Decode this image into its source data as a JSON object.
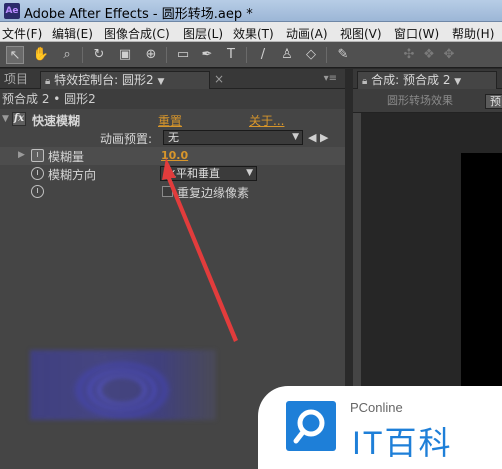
{
  "window": {
    "title": "Adobe After Effects - 圆形转场.aep *",
    "app_icon_text": "Ae"
  },
  "menu": [
    "文件(F)",
    "编辑(E)",
    "图像合成(C)",
    "图层(L)",
    "效果(T)",
    "动画(A)",
    "视图(V)",
    "窗口(W)",
    "帮助(H)"
  ],
  "toolbar": {
    "icons": [
      "selection-tool-icon",
      "hand-tool-icon",
      "zoom-tool-icon",
      "rotate-tool-icon",
      "camera-tool-icon",
      "pan-behind-icon",
      "rectangle-tool-icon",
      "pen-tool-icon",
      "type-tool-icon",
      "brush-tool-icon",
      "clone-stamp-icon",
      "eraser-tool-icon",
      "puppet-pin-icon"
    ],
    "right_icons": [
      "axis-icon",
      "axis-icon-2",
      "axis-icon-3"
    ]
  },
  "effects_panel": {
    "project_tab": "项目",
    "tab_label": "特效控制台: 圆形2",
    "breadcrumb": "预合成 2 • 圆形2",
    "effect": {
      "name": "快速模糊",
      "reset": "重置",
      "about": "关于...",
      "preset_label": "动画预置:",
      "preset_value": "无",
      "blurriness_label": "模糊量",
      "blurriness_value": "10.0",
      "direction_label": "模糊方向",
      "direction_value": "水平和垂直",
      "repeat_edge_label": "重复边缘像素",
      "repeat_edge_checked": false
    }
  },
  "comp_panel": {
    "tab_label": "合成: 预合成 2",
    "crumb_1": "圆形转场效果",
    "crumb_2": "预"
  },
  "watermark": {
    "brand_small": "PConline",
    "brand_big": "IT百科"
  },
  "colors": {
    "accent_link": "#d8962b",
    "annotation": "#e23c3c",
    "brand_blue": "#1e7fd8"
  }
}
